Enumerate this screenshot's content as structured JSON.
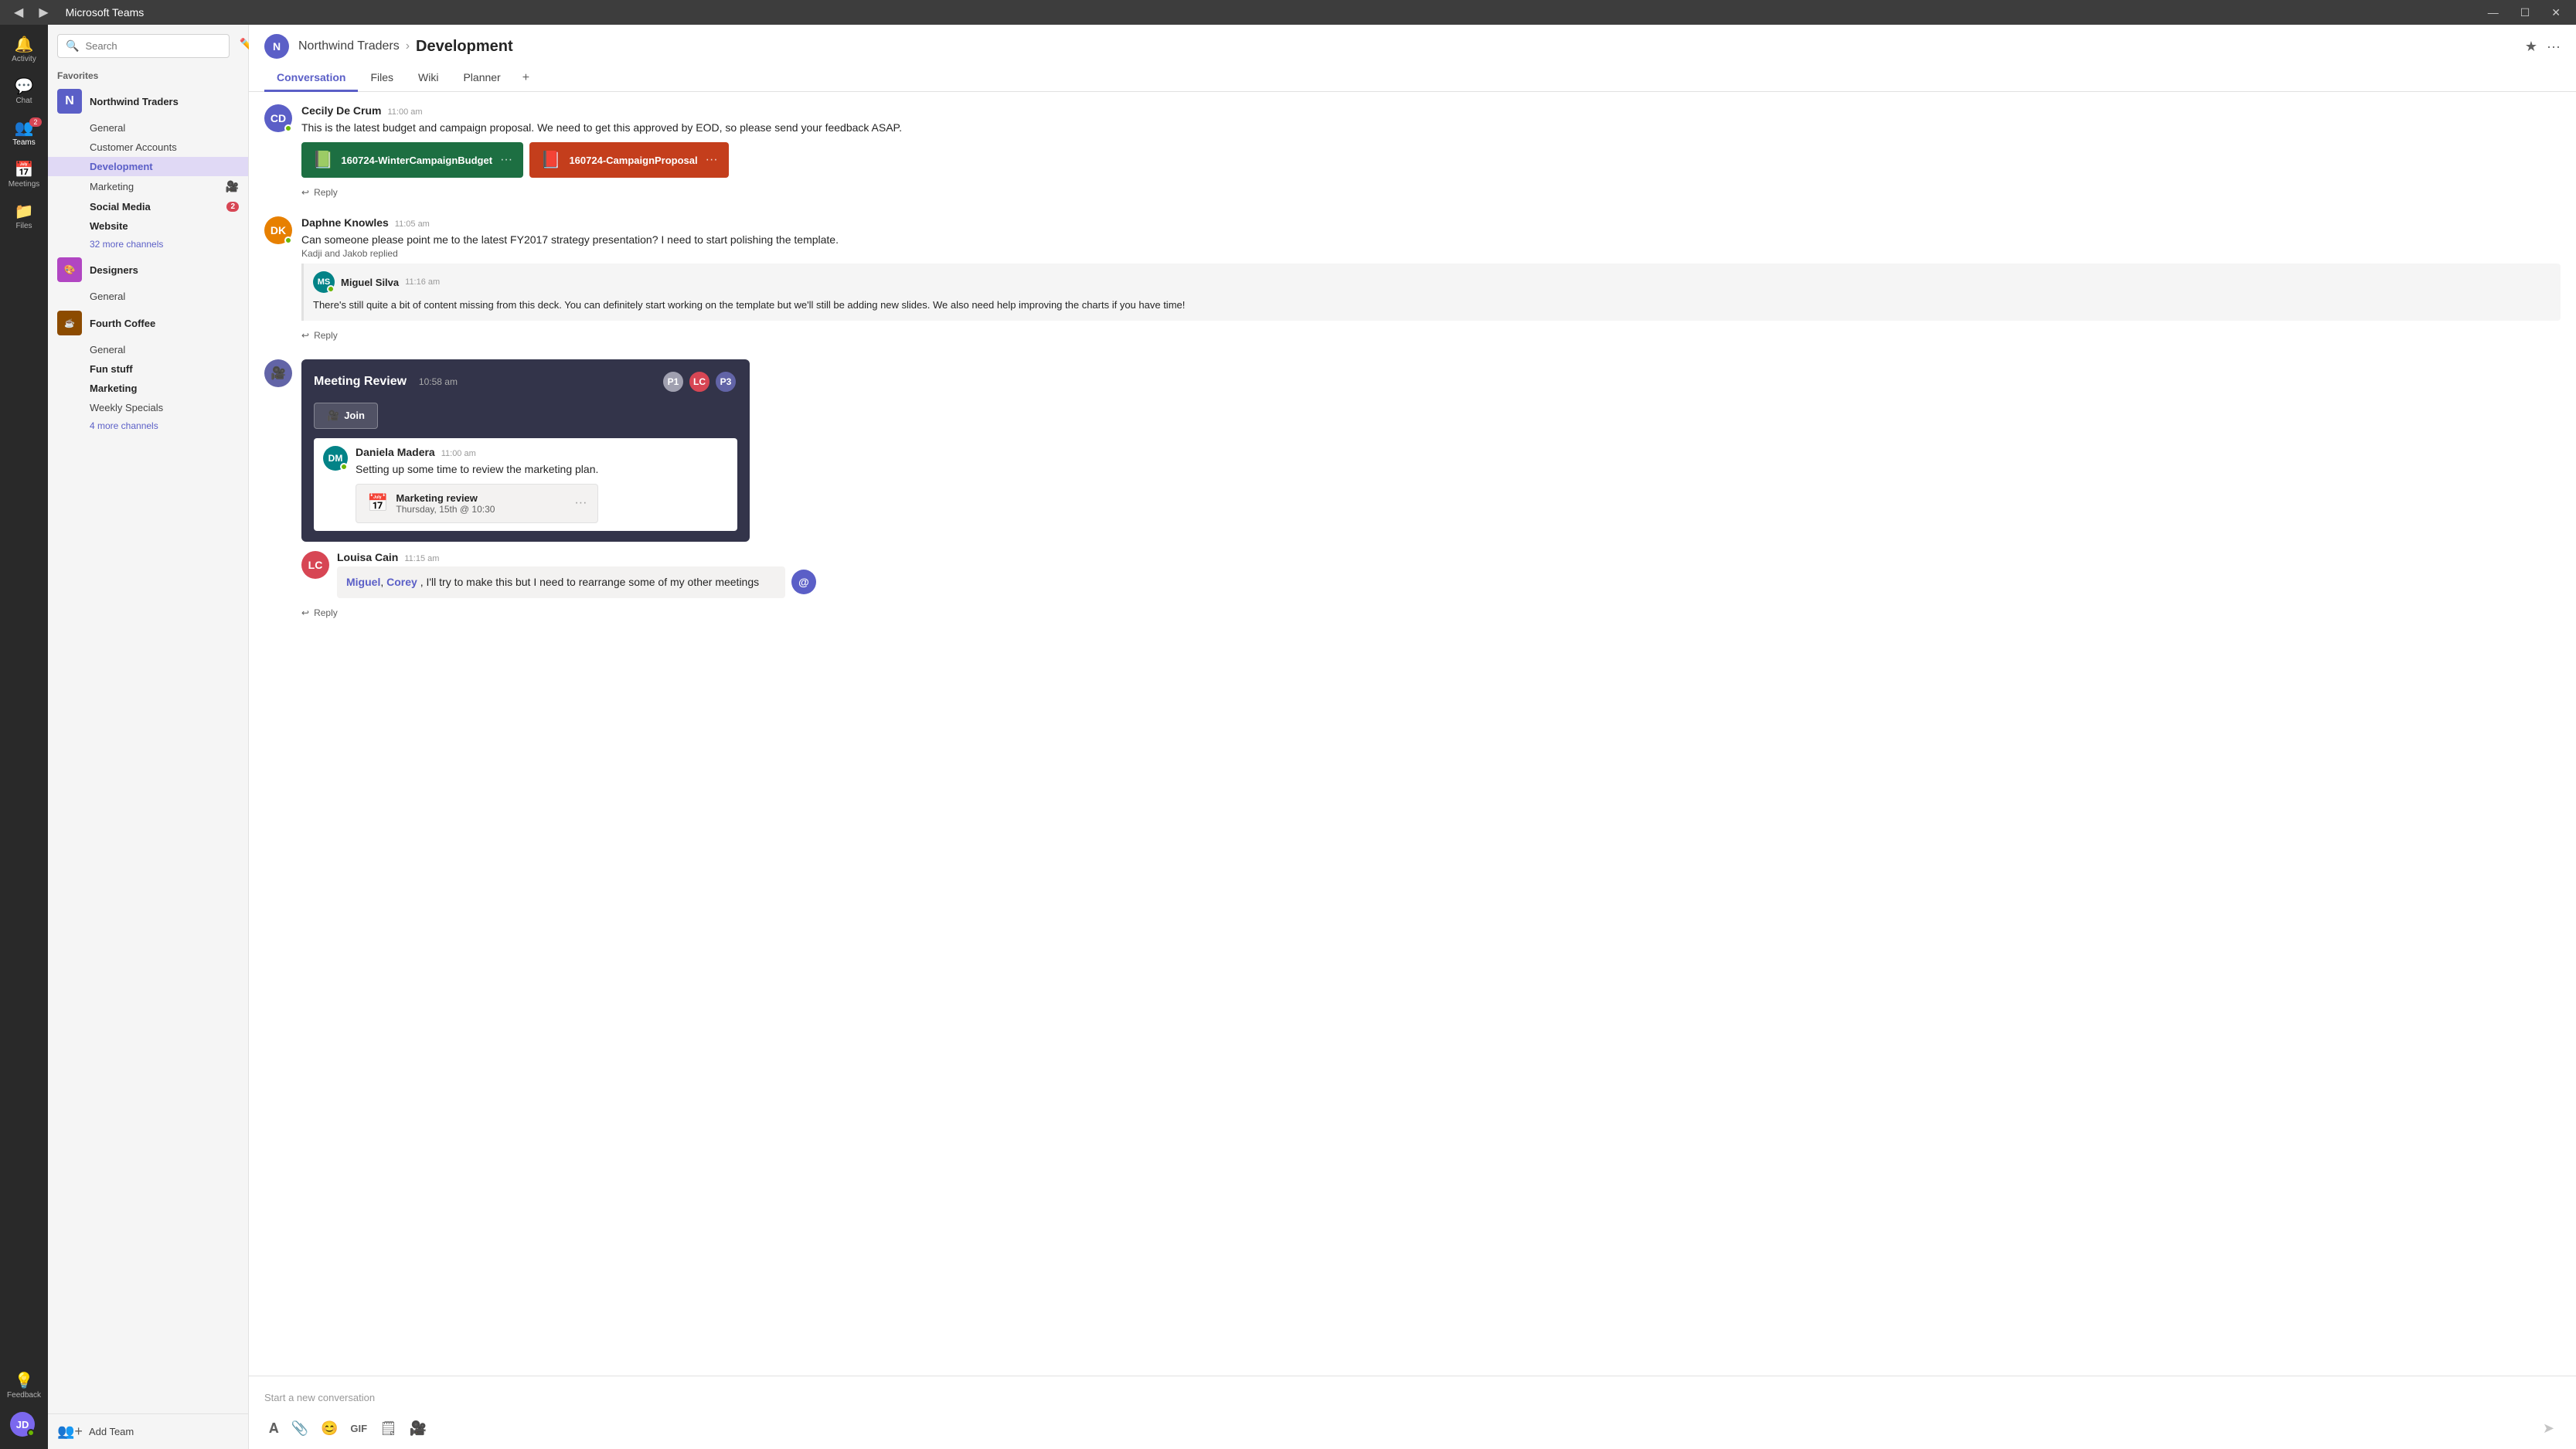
{
  "titlebar": {
    "title": "Microsoft Teams",
    "nav_back": "◀",
    "nav_forward": "▶",
    "min": "—",
    "max": "☐",
    "close": "✕"
  },
  "nav": {
    "items": [
      {
        "id": "activity",
        "label": "Activity",
        "icon": "🔔"
      },
      {
        "id": "chat",
        "label": "Chat",
        "icon": "💬"
      },
      {
        "id": "teams",
        "label": "Teams",
        "icon": "👥",
        "badge": "2"
      },
      {
        "id": "meetings",
        "label": "Meetings",
        "icon": "📅"
      },
      {
        "id": "files",
        "label": "Files",
        "icon": "📁"
      }
    ],
    "feedback": "Feedback",
    "user_initials": "JD"
  },
  "sidebar": {
    "search_placeholder": "Search",
    "favorites_label": "Favorites",
    "teams": [
      {
        "id": "northwind",
        "name": "Northwind Traders",
        "icon": "N",
        "bg": "#5b5fc7",
        "channels": [
          {
            "name": "General",
            "active": false,
            "bold": false
          },
          {
            "name": "Customer Accounts",
            "active": false,
            "bold": false
          },
          {
            "name": "Development",
            "active": true,
            "bold": false
          },
          {
            "name": "Marketing",
            "active": false,
            "bold": false,
            "video": true
          },
          {
            "name": "Social Media",
            "active": false,
            "bold": true,
            "badge": "2"
          },
          {
            "name": "Website",
            "active": false,
            "bold": true
          }
        ],
        "more_channels": "32 more channels"
      },
      {
        "id": "designers",
        "name": "Designers",
        "icon": "D",
        "bg": "#b146c2",
        "channels": [
          {
            "name": "General",
            "active": false,
            "bold": false
          }
        ]
      },
      {
        "id": "fourthcoffee",
        "name": "Fourth Coffee",
        "icon": "FC",
        "bg": "#8c4b00",
        "channels": [
          {
            "name": "General",
            "active": false,
            "bold": false
          },
          {
            "name": "Fun stuff",
            "active": false,
            "bold": true
          },
          {
            "name": "Marketing",
            "active": false,
            "bold": true
          },
          {
            "name": "Weekly Specials",
            "active": false,
            "bold": false
          }
        ],
        "more_channels": "4 more channels"
      }
    ],
    "add_team": "Add Team"
  },
  "channel": {
    "team_name": "Northwind Traders",
    "channel_name": "Development",
    "tabs": [
      {
        "id": "conversation",
        "label": "Conversation",
        "active": true
      },
      {
        "id": "files",
        "label": "Files",
        "active": false
      },
      {
        "id": "wiki",
        "label": "Wiki",
        "active": false
      },
      {
        "id": "planner",
        "label": "Planner",
        "active": false
      }
    ]
  },
  "messages": [
    {
      "id": "msg1",
      "author": "Cecily De Crum",
      "initials": "CD",
      "avatar_bg": "#5b5fc7",
      "time": "11:00 am",
      "online": true,
      "text": "This is the latest budget and campaign proposal. We need to get this approved by EOD, so please send your feedback ASAP.",
      "attachments": [
        {
          "type": "excel",
          "name": "160724-WinterCampaignBudget"
        },
        {
          "type": "ppt",
          "name": "160724-CampaignProposal"
        }
      ],
      "reply_label": "Reply"
    },
    {
      "id": "msg2",
      "author": "Daphne Knowles",
      "initials": "DK",
      "avatar_bg": "#e78000",
      "time": "11:05 am",
      "online": true,
      "text": "Can someone please point me to the latest FY2017 strategy presentation? I need to start polishing the template.",
      "replied_by": "Kadji and Jakob replied",
      "thread": {
        "author": "Miguel Silva",
        "initials": "MS",
        "avatar_bg": "#038387",
        "time": "11:16 am",
        "online": true,
        "text": "There's still quite a bit of content missing from this deck. You can definitely start working on the template but we'll still be adding new slides. We also need help improving the charts if you have time!"
      },
      "reply_label": "Reply"
    },
    {
      "id": "msg3",
      "is_meeting": true,
      "meeting_title": "Meeting Review",
      "meeting_time": "10:58 am",
      "join_label": "Join",
      "nested": {
        "author": "Daniela Madera",
        "initials": "DM",
        "avatar_bg": "#038387",
        "time": "11:00 am",
        "online": true,
        "text": "Setting up some time to review the marketing plan.",
        "calendar": {
          "title": "Marketing review",
          "subtitle": "Thursday, 15th @ 10:30"
        }
      },
      "reply": {
        "author": "Louisa Cain",
        "initials": "LC",
        "avatar_bg": "#d74654",
        "time": "11:15 am",
        "text_before": "",
        "mentions": [
          "Miguel",
          "Corey"
        ],
        "text_after": ", I'll try to make this but I need to rearrange some of my other meetings",
        "reaction_icon": "@"
      },
      "reply_label": "Reply"
    }
  ],
  "compose": {
    "placeholder": "Start a new conversation",
    "toolbar": {
      "format": "A",
      "attach": "📎",
      "emoji": "😊",
      "gif": "GIF",
      "sticker": "🗒",
      "video": "🎥",
      "send": "➤"
    }
  }
}
